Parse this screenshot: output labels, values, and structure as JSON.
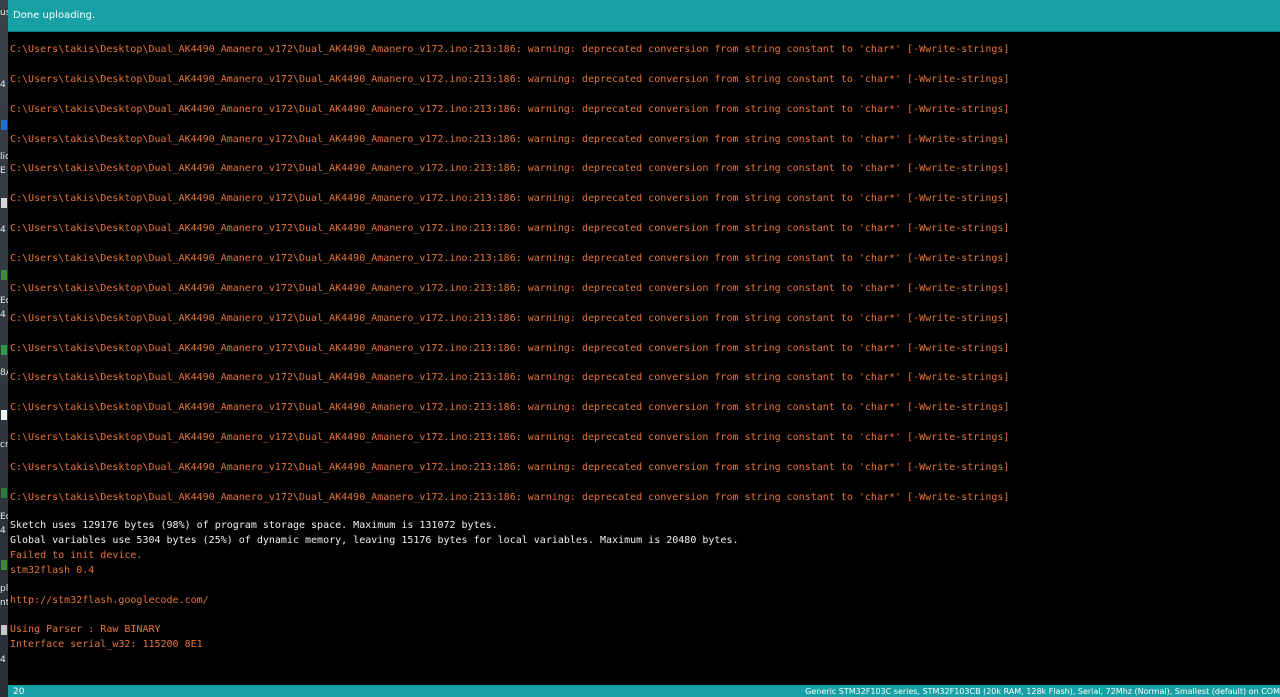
{
  "status": {
    "message": "Done uploading."
  },
  "warning_line": "C:\\Users\\takis\\Desktop\\Dual_AK4490_Amanero_v172\\Dual_AK4490_Amanero_v172.ino:213:186: warning: deprecated conversion from string constant to 'char*' [-Wwrite-strings]",
  "console": {
    "lines": [
      {
        "text": "Sketch uses 129176 bytes (98%) of program storage space. Maximum is 131072 bytes.",
        "kind": "info"
      },
      {
        "text": "Global variables use 5304 bytes (25%) of dynamic memory, leaving 15176 bytes for local variables. Maximum is 20480 bytes.",
        "kind": "info"
      },
      {
        "text": "Failed to init device.",
        "kind": "err"
      },
      {
        "text": "stm32flash 0.4",
        "kind": "err"
      },
      {
        "text": "",
        "kind": "err"
      },
      {
        "text": "http://stm32flash.googlecode.com/",
        "kind": "err"
      },
      {
        "text": "",
        "kind": "err"
      },
      {
        "text": "Using Parser : Raw BINARY",
        "kind": "err"
      },
      {
        "text": "Interface serial_w32: 115200 8E1",
        "kind": "err"
      }
    ]
  },
  "footer": {
    "line_number": "20",
    "board": "Generic STM32F103C series, STM32F103CB (20k RAM, 128k Flash), Serial, 72Mhz (Normal), Smallest (default) on COM"
  },
  "desktop_fragments": [
    "us",
    "4",
    "lic",
    "E",
    "4",
    "Ec",
    "4",
    "8A",
    "cr",
    "Ec",
    "4",
    "pl",
    "nt",
    "4"
  ],
  "colors": {
    "status_bar": "#17a1a5",
    "console_bg": "#000000",
    "warning": "#e5753a",
    "info": "#f0f0f0"
  }
}
